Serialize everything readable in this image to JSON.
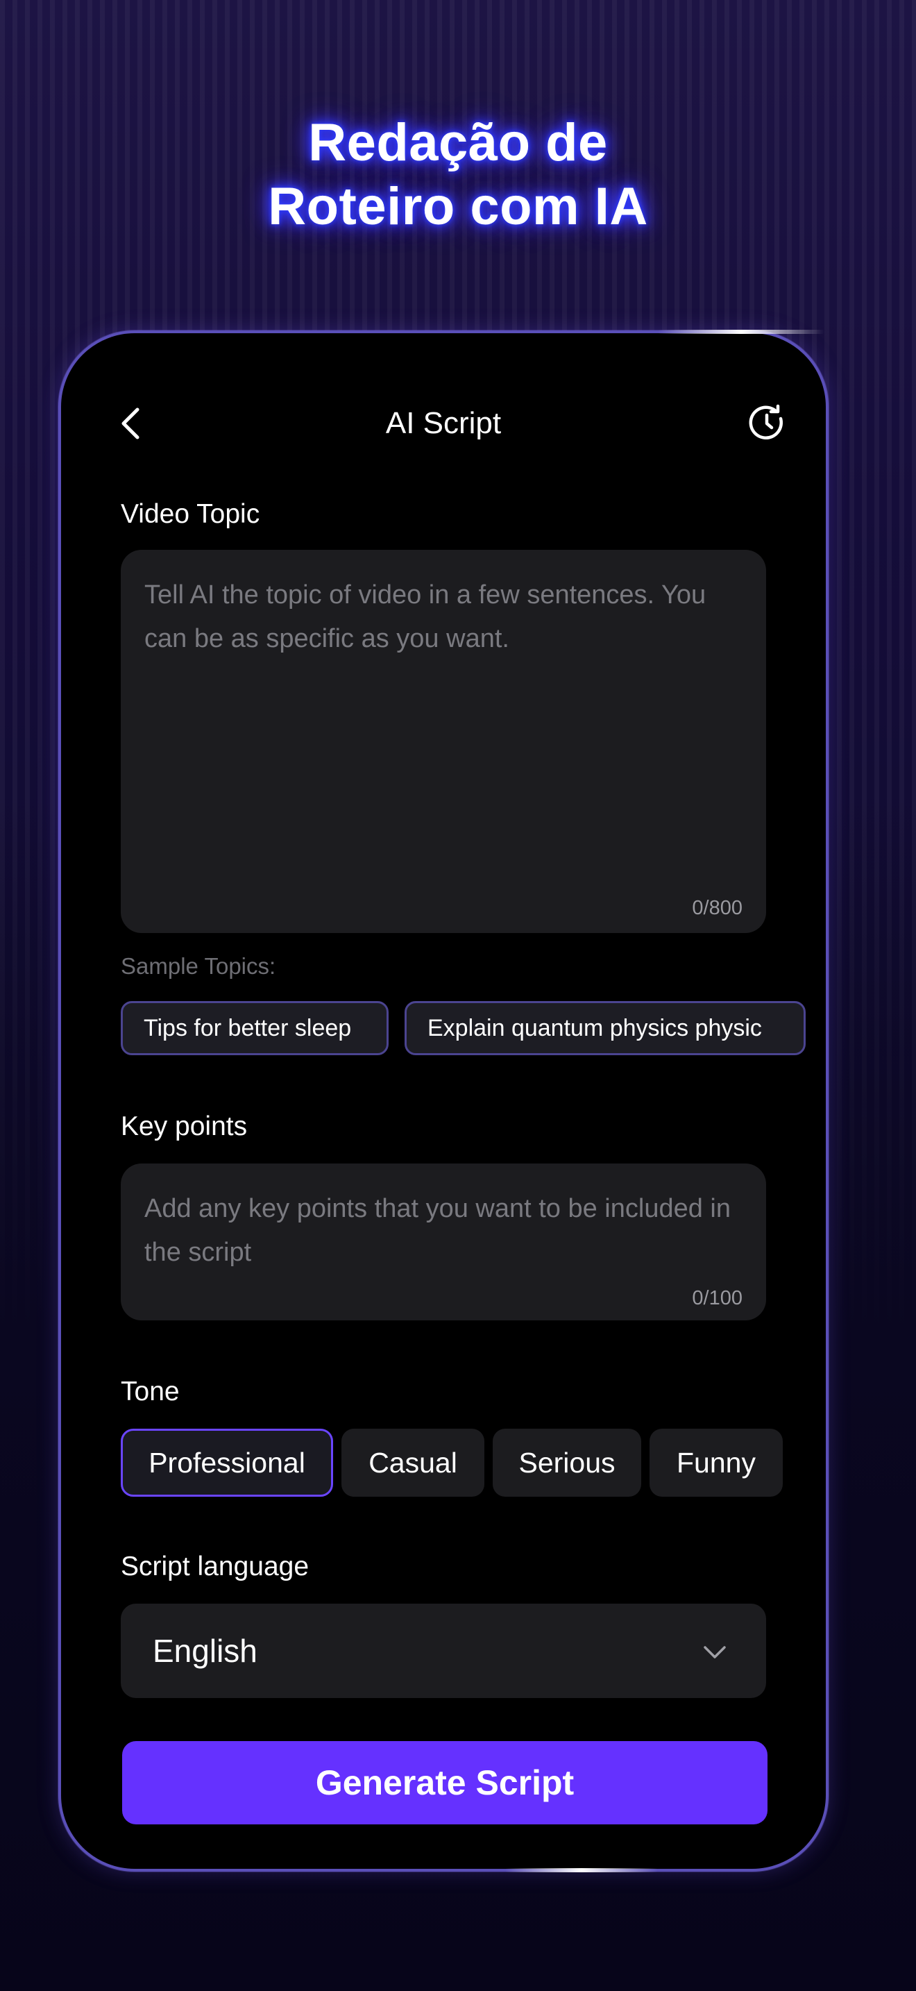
{
  "headline": {
    "line1": "Redação de",
    "line2": "Roteiro com IA"
  },
  "header": {
    "title": "AI Script",
    "back_icon": "chevron-left-icon",
    "history_icon": "history-clock-icon"
  },
  "video_topic": {
    "label": "Video Topic",
    "placeholder": "Tell AI the topic of video in a few sentences. You can be as specific as you want.",
    "counter": "0/800"
  },
  "sample_topics": {
    "label": "Sample Topics:",
    "items": [
      "Tips for better sleep",
      "Explain quantum physics physic"
    ]
  },
  "key_points": {
    "label": "Key points",
    "placeholder": "Add any key points that you want to be included in the script",
    "counter": "0/100"
  },
  "tone": {
    "label": "Tone",
    "options": [
      "Professional",
      "Casual",
      "Serious",
      "Funny"
    ],
    "selected": "Professional"
  },
  "script_language": {
    "label": "Script language",
    "value": "English"
  },
  "generate_button": {
    "label": "Generate Script"
  },
  "colors": {
    "accent": "#6531ff",
    "selected_border": "#6a45ff",
    "field_bg": "#1c1c1f",
    "headline_glow": "#2d3bff"
  }
}
